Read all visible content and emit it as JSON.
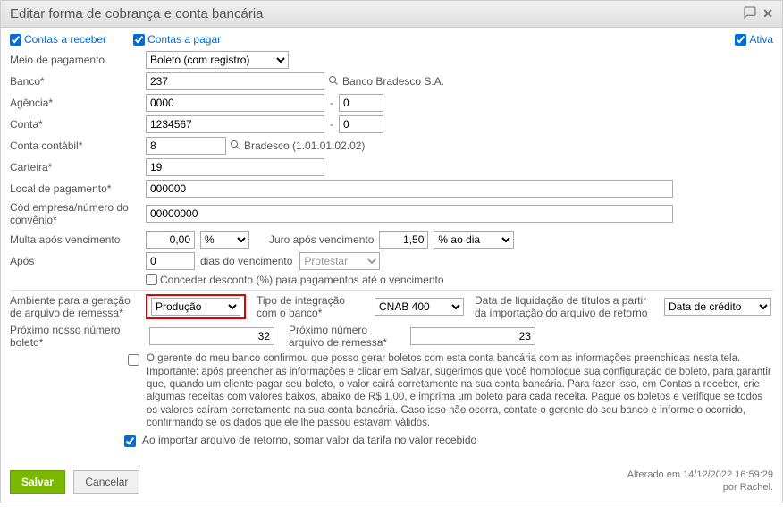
{
  "title": "Editar forma de cobrança e conta bancária",
  "top": {
    "receber": "Contas a receber",
    "pagar": "Contas a pagar",
    "ativa": "Ativa"
  },
  "labels": {
    "meio": "Meio de pagamento",
    "banco": "Banco*",
    "agencia": "Agência*",
    "conta": "Conta*",
    "conta_contabil": "Conta contábil*",
    "carteira": "Carteira*",
    "local": "Local de pagamento*",
    "cod_conv": "Cód empresa/número do convênio*",
    "multa": "Multa após vencimento",
    "juro": "Juro após vencimento",
    "apos": "Após",
    "dias": "dias do vencimento",
    "conceder": "Conceder desconto (%) para pagamentos até o vencimento",
    "ambiente": "Ambiente para a geração de arquivo de remessa*",
    "tipo_integ": "Tipo de integração com o banco*",
    "data_liq": "Data de liquidação de títulos a partir da importação do arquivo de retorno",
    "prox_boleto": "Próximo nosso número boleto*",
    "prox_remessa": "Próximo número arquivo de remessa*",
    "importar": "Ao importar arquivo de retorno, somar valor da tarifa no valor recebido"
  },
  "values": {
    "meio": "Boleto (com registro)",
    "banco": "237",
    "banco_nome": "Banco Bradesco S.A.",
    "agencia": "0000",
    "agencia_dv": "0",
    "conta": "1234567",
    "conta_dv": "0",
    "conta_contabil": "8",
    "conta_contabil_nome": "Bradesco (1.01.01.02.02)",
    "carteira": "19",
    "local": "000000",
    "cod_conv": "00000000",
    "multa_valor": "0,00",
    "multa_tipo": "%",
    "juro_valor": "1,50",
    "juro_tipo": "% ao dia",
    "apos_dias": "0",
    "protestar": "Protestar",
    "ambiente": "Produção",
    "tipo_integ": "CNAB 400",
    "data_liq": "Data de crédito",
    "prox_boleto": "32",
    "prox_remessa": "23"
  },
  "note": "O gerente do meu banco confirmou que posso gerar boletos com esta conta bancária com as informações preenchidas nesta tela. Importante: após preencher as informações e clicar em Salvar, sugerimos que você homologue sua configuração de boleto, para garantir que, quando um cliente pagar seu boleto, o valor cairá corretamente na sua conta bancária. Para fazer isso, em Contas a receber, crie algumas receitas com valores baixos, abaixo de R$ 1,00, e imprima um boleto para cada receita. Pague os boletos e verifique se todos os valores caíram corretamente na sua conta bancária. Caso isso não ocorra, contate o gerente do seu banco e informe o ocorrido, confirmando se os dados que ele lhe passou estavam válidos.",
  "footer": {
    "salvar": "Salvar",
    "cancelar": "Cancelar",
    "alterado": "Alterado em 14/12/2022 16:59:29",
    "por": "por Rachel."
  }
}
